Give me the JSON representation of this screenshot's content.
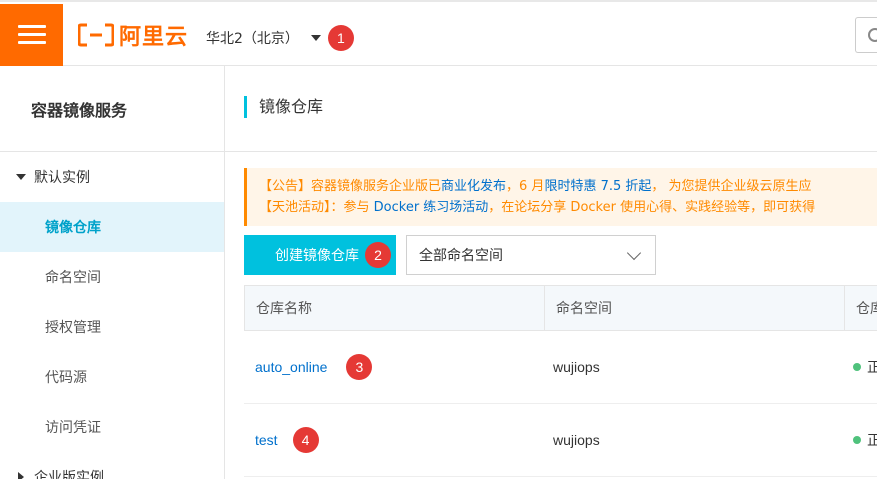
{
  "header": {
    "brand": "阿里云",
    "region": "华北2（北京）",
    "badge_region": "1"
  },
  "sidebar": {
    "title": "容器镜像服务",
    "group_default": "默认实例",
    "items": [
      {
        "label": "镜像仓库",
        "active": true
      },
      {
        "label": "命名空间"
      },
      {
        "label": "授权管理"
      },
      {
        "label": "代码源"
      },
      {
        "label": "访问凭证"
      }
    ],
    "group_enterprise": "企业版实例"
  },
  "main": {
    "title": "镜像仓库",
    "notice": {
      "line1_prefix": "【公告】容器镜像服务企业版已",
      "line1_link1": "商业化发布",
      "line1_mid": "，6 月",
      "line1_link2": "限时特惠 7.5 折起",
      "line1_suffix": "， 为您提供企业级云原生应",
      "line2_prefix": "【天池活动】：参与 ",
      "line2_link": "Docker 练习场活动",
      "line2_suffix": "，在论坛分享 Docker 使用心得、实践经验等，即可获得"
    },
    "create_button": "创建镜像仓库",
    "badge_create": "2",
    "namespace_select": "全部命名空间",
    "table": {
      "columns": [
        "仓库名称",
        "命名空间",
        "仓库"
      ],
      "rows": [
        {
          "name": "auto_online",
          "badge": "3",
          "namespace": "wujiops",
          "status": "正常"
        },
        {
          "name": "test",
          "badge": "4",
          "namespace": "wujiops",
          "status": "正常"
        }
      ]
    }
  },
  "colors": {
    "brand": "#ff6a00",
    "accent": "#00c1de",
    "link": "#0070cc",
    "badge": "#e53935",
    "status_ok": "#4fc27c"
  }
}
